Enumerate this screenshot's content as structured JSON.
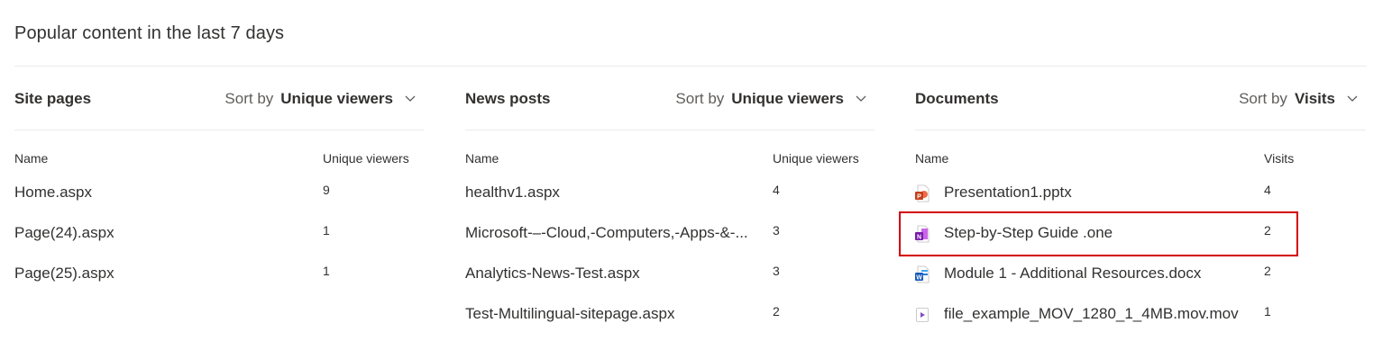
{
  "page": {
    "title": "Popular content in the last 7 days"
  },
  "panels": {
    "site_pages": {
      "title": "Site pages",
      "sort_label": "Sort by",
      "sort_value": "Unique viewers",
      "col_name": "Name",
      "col_metric": "Unique viewers",
      "rows": [
        {
          "name": "Home.aspx",
          "value": "9"
        },
        {
          "name": "Page(24).aspx",
          "value": "1"
        },
        {
          "name": "Page(25).aspx",
          "value": "1"
        }
      ]
    },
    "news_posts": {
      "title": "News posts",
      "sort_label": "Sort by",
      "sort_value": "Unique viewers",
      "col_name": "Name",
      "col_metric": "Unique viewers",
      "rows": [
        {
          "name": "healthv1.aspx",
          "value": "4"
        },
        {
          "name": "Microsoft-–-Cloud,-Computers,-Apps-&-...",
          "value": "3"
        },
        {
          "name": "Analytics-News-Test.aspx",
          "value": "3"
        },
        {
          "name": "Test-Multilingual-sitepage.aspx",
          "value": "2"
        }
      ]
    },
    "documents": {
      "title": "Documents",
      "sort_label": "Sort by",
      "sort_value": "Visits",
      "col_name": "Name",
      "col_metric": "Visits",
      "rows": [
        {
          "name": "Presentation1.pptx",
          "value": "4",
          "icon": "powerpoint-icon"
        },
        {
          "name": "Step-by-Step Guide .one",
          "value": "2",
          "icon": "onenote-icon"
        },
        {
          "name": "Module 1 - Additional Resources.docx",
          "value": "2",
          "icon": "word-icon"
        },
        {
          "name": "file_example_MOV_1280_1_4MB.mov.mov",
          "value": "1",
          "icon": "video-icon"
        }
      ]
    }
  },
  "colors": {
    "highlight": "#d40000",
    "powerpoint": "#c43e1c",
    "onenote": "#7719aa",
    "word": "#185abd",
    "video": "#8a4cc4"
  }
}
